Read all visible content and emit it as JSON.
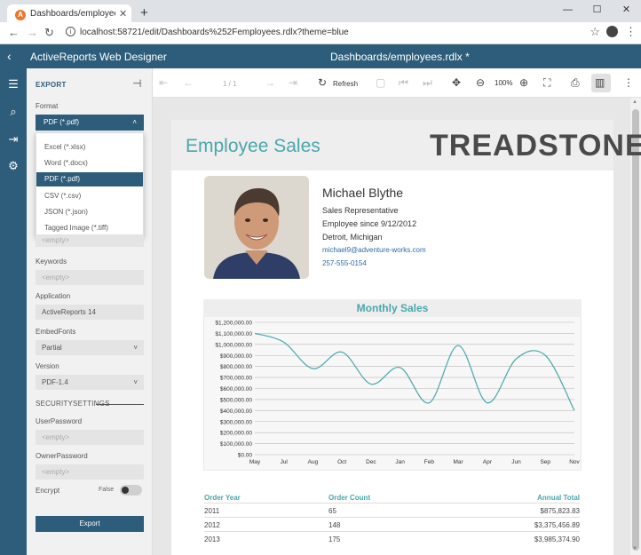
{
  "browser": {
    "tab_title": "Dashboards/employees.rdlx",
    "favicon_letter": "A",
    "url": "localhost:58721/edit/Dashboards%252Femployees.rdlx?theme=blue"
  },
  "app": {
    "title": "ActiveReports Web Designer",
    "document": "Dashboards/employees.rdlx *"
  },
  "panel": {
    "title": "EXPORT",
    "format_label": "Format",
    "format_value": "PDF (*.pdf)",
    "format_options": [
      "Excel (*.xlsx)",
      "Word (*.docx)",
      "PDF (*.pdf)",
      "CSV (*.csv)",
      "JSON (*.json)",
      "Tagged Image (*.tiff)"
    ],
    "empty_placeholder": "<empty>",
    "keywords_label": "Keywords",
    "application_label": "Application",
    "application_value": "ActiveReports 14",
    "embedfonts_label": "EmbedFonts",
    "embedfonts_value": "Partial",
    "version_label": "Version",
    "version_value": "PDF-1.4",
    "security_header": "SECURITYSETTINGS",
    "userpassword_label": "UserPassword",
    "ownerpassword_label": "OwnerPassword",
    "encrypt_label": "Encrypt",
    "encrypt_value": "False",
    "export_button": "Export"
  },
  "toolbar": {
    "page_indicator": "1 / 1",
    "refresh_label": "Refresh",
    "zoom_level": "100%"
  },
  "report": {
    "title": "Employee Sales",
    "logo": "TREADSTONE",
    "employee": {
      "name": "Michael Blythe",
      "role": "Sales Representative",
      "since": "Employee since 9/12/2012",
      "location": "Detroit, Michigan",
      "email": "michael9@adventure-works.com",
      "phone": "257-555-0154"
    },
    "table": {
      "headers": [
        "Order Year",
        "Order Count",
        "Annual Total"
      ],
      "rows": [
        [
          "2011",
          "65",
          "$875,823.83"
        ],
        [
          "2012",
          "148",
          "$3,375,456.89"
        ],
        [
          "2013",
          "175",
          "$3,985,374.90"
        ]
      ]
    }
  },
  "colors": {
    "accent": "#2d5d7b",
    "teal": "#4aa7ab",
    "line": "#4aa7ab"
  },
  "chart_data": {
    "type": "line",
    "title": "Monthly Sales",
    "categories": [
      "May",
      "Jul",
      "Aug",
      "Oct",
      "Dec",
      "Jan",
      "Feb",
      "Mar",
      "Apr",
      "Jun",
      "Sep",
      "Nov"
    ],
    "values": [
      1100000,
      1020000,
      780000,
      930000,
      640000,
      790000,
      470000,
      990000,
      470000,
      870000,
      900000,
      400000
    ],
    "ylim": [
      0,
      1200000
    ],
    "ytick_labels": [
      "$0.00",
      "$100,000.00",
      "$200,000.00",
      "$300,000.00",
      "$400,000.00",
      "$500,000.00",
      "$600,000.00",
      "$700,000.00",
      "$800,000.00",
      "$900,000.00",
      "$1,000,000.00",
      "$1,100,000.00",
      "$1,200,000.00"
    ],
    "grid": true,
    "xlabel": "",
    "ylabel": ""
  }
}
